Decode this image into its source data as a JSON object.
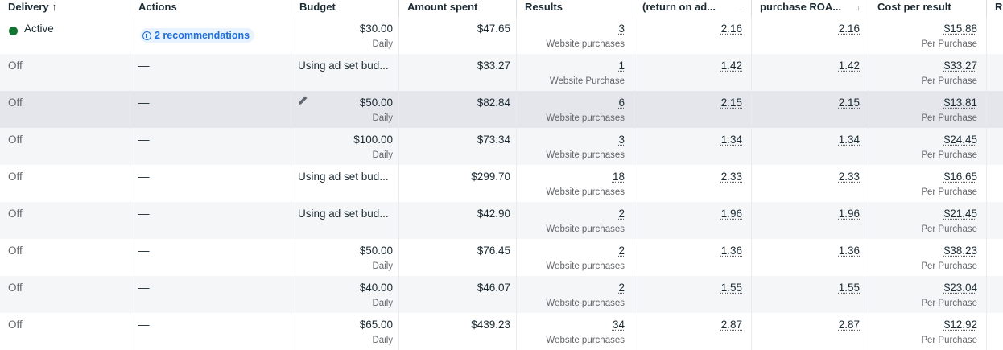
{
  "header": {
    "columns": [
      {
        "label": "Delivery ↑",
        "sort": ""
      },
      {
        "label": "Actions",
        "sort": ""
      },
      {
        "label": "Budget",
        "sort": ""
      },
      {
        "label": "Amount spent",
        "sort": ""
      },
      {
        "label": "Results",
        "sort": ""
      },
      {
        "label": "(return on ad...",
        "sort": "↓"
      },
      {
        "label": "purchase ROA...",
        "sort": "↓"
      },
      {
        "label": "Cost per result",
        "sort": ""
      },
      {
        "label": "R",
        "sort": ""
      }
    ]
  },
  "rows": [
    {
      "delivery": "Active",
      "active": true,
      "actions": "2 recommendations",
      "budget": "$30.00",
      "budget_period": "Daily",
      "spent": "$47.65",
      "results": "3",
      "results_type": "Website purchases",
      "roas": "2.16",
      "purchase_roas": "2.16",
      "cost": "$15.88",
      "cost_type": "Per Purchase"
    },
    {
      "delivery": "Off",
      "active": false,
      "actions": "—",
      "budget": "Using ad set bud...",
      "budget_period": "",
      "spent": "$33.27",
      "results": "1",
      "results_type": "Website Purchase",
      "roas": "1.42",
      "purchase_roas": "1.42",
      "cost": "$33.27",
      "cost_type": "Per Purchase"
    },
    {
      "delivery": "Off",
      "active": false,
      "actions": "—",
      "budget": "$50.00",
      "budget_period": "Daily",
      "spent": "$82.84",
      "results": "6",
      "results_type": "Website purchases",
      "roas": "2.15",
      "purchase_roas": "2.15",
      "cost": "$13.81",
      "cost_type": "Per Purchase",
      "hover": true
    },
    {
      "delivery": "Off",
      "active": false,
      "actions": "—",
      "budget": "$100.00",
      "budget_period": "Daily",
      "spent": "$73.34",
      "results": "3",
      "results_type": "Website purchases",
      "roas": "1.34",
      "purchase_roas": "1.34",
      "cost": "$24.45",
      "cost_type": "Per Purchase"
    },
    {
      "delivery": "Off",
      "active": false,
      "actions": "—",
      "budget": "Using ad set bud...",
      "budget_period": "",
      "spent": "$299.70",
      "results": "18",
      "results_type": "Website purchases",
      "roas": "2.33",
      "purchase_roas": "2.33",
      "cost": "$16.65",
      "cost_type": "Per Purchase"
    },
    {
      "delivery": "Off",
      "active": false,
      "actions": "—",
      "budget": "Using ad set bud...",
      "budget_period": "",
      "spent": "$42.90",
      "results": "2",
      "results_type": "Website purchases",
      "roas": "1.96",
      "purchase_roas": "1.96",
      "cost": "$21.45",
      "cost_type": "Per Purchase"
    },
    {
      "delivery": "Off",
      "active": false,
      "actions": "—",
      "budget": "$50.00",
      "budget_period": "Daily",
      "spent": "$76.45",
      "results": "2",
      "results_type": "Website purchases",
      "roas": "1.36",
      "purchase_roas": "1.36",
      "cost": "$38.23",
      "cost_type": "Per Purchase"
    },
    {
      "delivery": "Off",
      "active": false,
      "actions": "—",
      "budget": "$40.00",
      "budget_period": "Daily",
      "spent": "$46.07",
      "results": "2",
      "results_type": "Website purchases",
      "roas": "1.55",
      "purchase_roas": "1.55",
      "cost": "$23.04",
      "cost_type": "Per Purchase"
    },
    {
      "delivery": "Off",
      "active": false,
      "actions": "—",
      "budget": "$65.00",
      "budget_period": "Daily",
      "spent": "$439.23",
      "results": "34",
      "results_type": "Website purchases",
      "roas": "2.87",
      "purchase_roas": "2.87",
      "cost": "$12.92",
      "cost_type": "Per Purchase"
    }
  ],
  "colors": {
    "active_dot": "#137333",
    "recommendation": "#216fdb",
    "hover_row": "#e4e6eb"
  }
}
